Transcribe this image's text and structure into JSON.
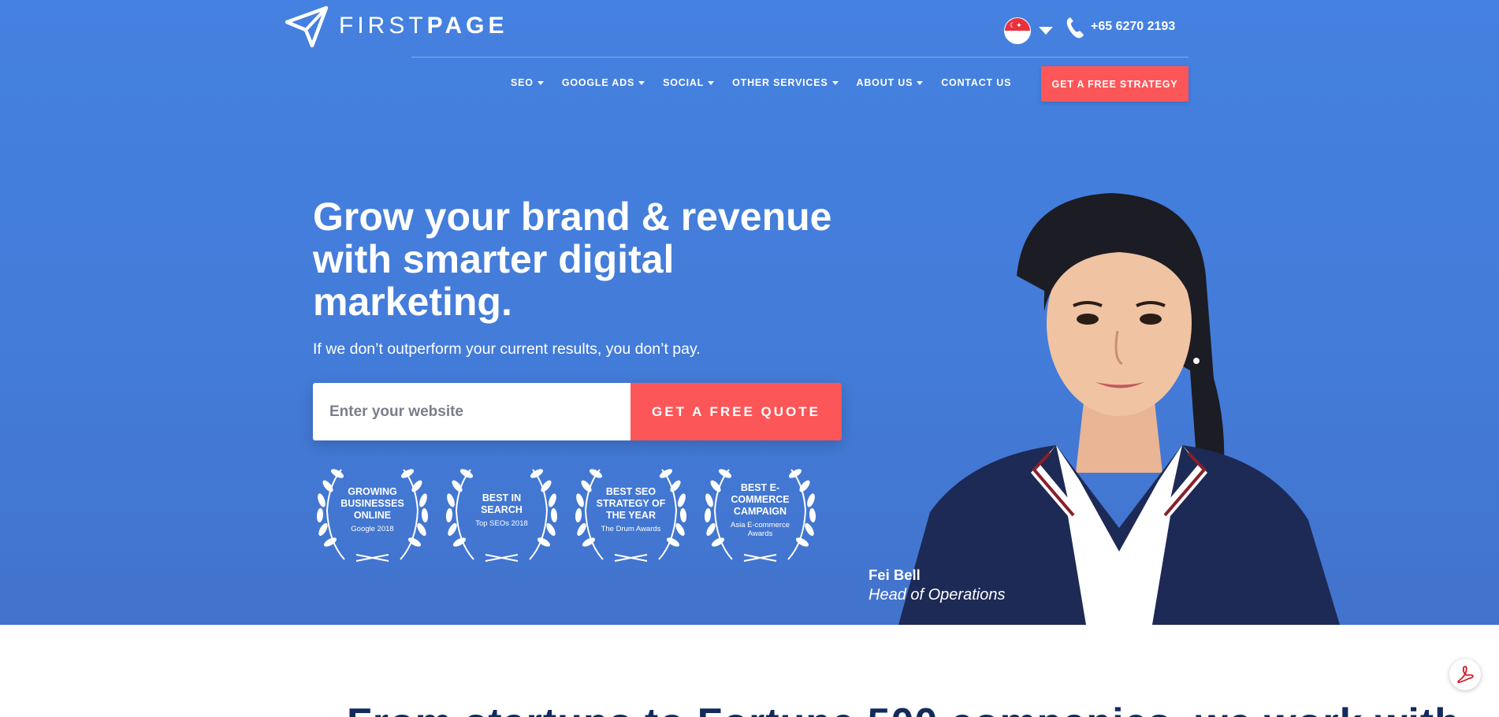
{
  "header": {
    "logo_light": "FIRST",
    "logo_bold": "PAGE",
    "phone": "+65 6270 2193",
    "nav": [
      {
        "label": "SEO",
        "has_dropdown": true
      },
      {
        "label": "GOOGLE ADS",
        "has_dropdown": true
      },
      {
        "label": "SOCIAL",
        "has_dropdown": true
      },
      {
        "label": "OTHER SERVICES",
        "has_dropdown": true
      },
      {
        "label": "ABOUT US",
        "has_dropdown": true
      },
      {
        "label": "CONTACT US",
        "has_dropdown": false
      }
    ],
    "cta": "GET A FREE STRATEGY"
  },
  "hero": {
    "headline": "Grow your brand & revenue with smarter digital marketing.",
    "subhead": "If we don’t outperform your current results, you don’t pay.",
    "input_placeholder": "Enter your website",
    "quote_button": "GET A FREE QUOTE",
    "awards": [
      {
        "title": "GROWING BUSINESSES ONLINE",
        "sub": "Google 2018"
      },
      {
        "title": "BEST IN SEARCH",
        "sub": "Top SEOs 2018"
      },
      {
        "title": "BEST SEO STRATEGY OF THE YEAR",
        "sub": "The Drum Awards"
      },
      {
        "title": "BEST E-COMMERCE CAMPAIGN",
        "sub": "Asia E-commerce Awards"
      }
    ],
    "person_name": "Fei Bell",
    "person_role": "Head of Operations"
  },
  "colors": {
    "hero_blue": "#4581e0",
    "accent_red": "#fd5658",
    "navy": "#132a5c"
  },
  "icons": [
    "paper-plane-logo-icon",
    "singapore-flag-icon",
    "chevron-down-icon",
    "phone-icon",
    "laurel-icon",
    "pdf-icon"
  ]
}
